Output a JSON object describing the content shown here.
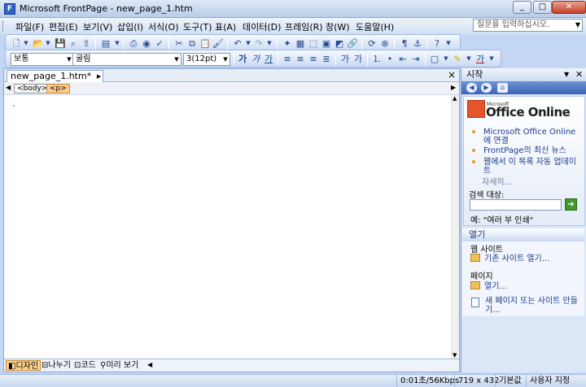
{
  "window": {
    "title": "Microsoft FrontPage - new_page_1.htm",
    "min_label": "_",
    "max_label": "□",
    "close_label": "✕"
  },
  "menu": {
    "items": [
      "파일(F)",
      "편집(E)",
      "보기(V)",
      "삽입(I)",
      "서식(O)",
      "도구(T)",
      "표(A)",
      "데이터(D)",
      "프레임(R)",
      "창(W)",
      "도움말(H)"
    ],
    "ask_placeholder": "질문을 입력하십시오."
  },
  "format_toolbar": {
    "style_value": "보통",
    "font_value": "굴림",
    "size_value": "3(12pt)"
  },
  "document": {
    "tab_label": "new_page_1.htm*",
    "tag_body": "<body>",
    "tag_p": "<p>",
    "caret_char": "`",
    "views": [
      "디자인",
      "나누기",
      "코드",
      "미리 보기"
    ]
  },
  "taskpane": {
    "title": "시작",
    "logo_small": "Microsoft",
    "logo_big": "Office Online",
    "links": [
      "Microsoft Office Online에 연결",
      "FrontPage의 최신 뉴스",
      "웹에서 이 목록 자동 업데이트"
    ],
    "more": "자세히...",
    "search_label": "검색 대상:",
    "search_example": "예: \"여러 부 인쇄\"",
    "open_title": "열기",
    "web_site_label": "웹 사이트",
    "open_site_link": "기존 사이트 열기...",
    "page_label": "페이지",
    "open_page_link": "열기...",
    "new_page_link": "새 페이지 또는 사이트 만들기..."
  },
  "status": {
    "speed": "0:01초/56Kbps",
    "dimensions": "719 x 432",
    "mode": "기본값",
    "custom": "사용자 지정"
  },
  "colors": {
    "accent": "#3c64b4",
    "selected_tag": "#ffc98a",
    "bullet": "#e39a24"
  }
}
